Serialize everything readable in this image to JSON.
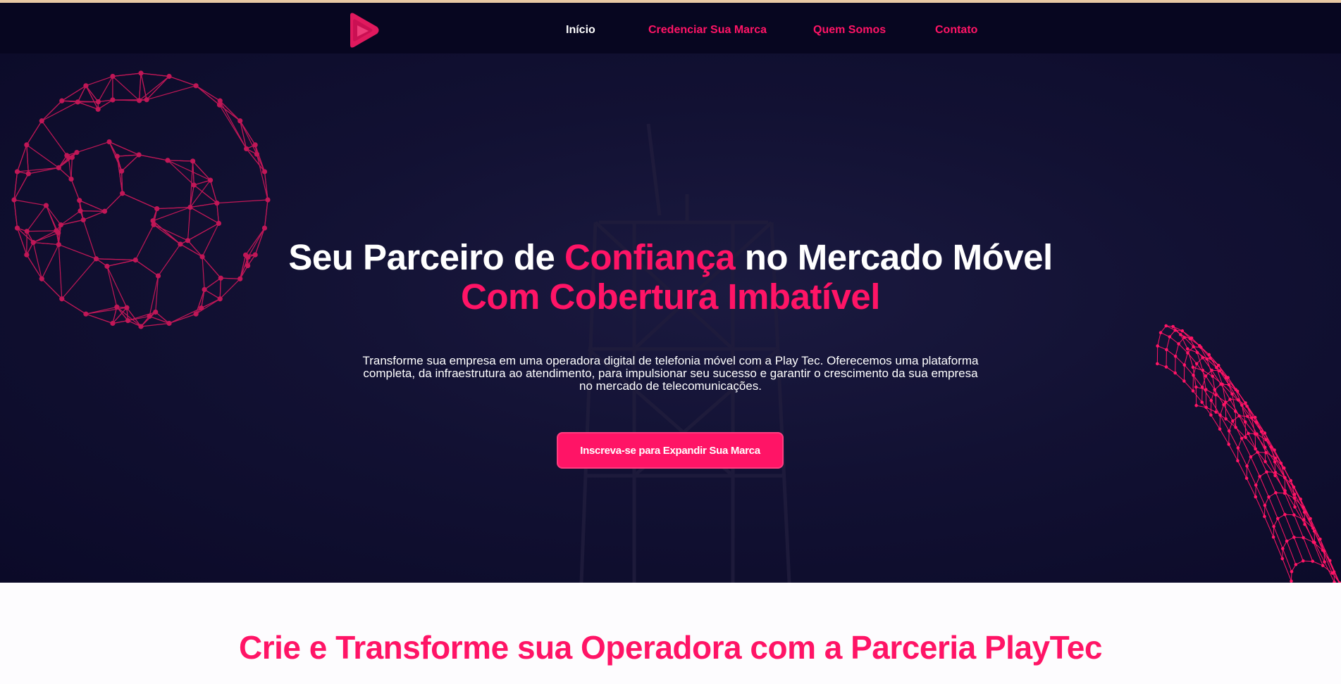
{
  "nav": {
    "logo": "playtec-logo",
    "items": [
      {
        "label": "Início",
        "active": true
      },
      {
        "label": "Credenciar Sua Marca",
        "active": false
      },
      {
        "label": "Quem Somos",
        "active": false
      },
      {
        "label": "Contato",
        "active": false
      }
    ]
  },
  "hero": {
    "title_part1": "Seu Parceiro de ",
    "title_highlight1": "Confiança",
    "title_part2": " no Mercado Móvel ",
    "title_highlight2": "Com Cobertura Imbatível",
    "description": "Transforme sua empresa em uma operadora digital de telefonia móvel com a Play Tec. Oferecemos uma plataforma completa, da infraestrutura ao atendimento, para impulsionar seu sucesso e garantir o crescimento da sua empresa no mercado de telecomunicações.",
    "cta_label": "Inscreva-se para Expandir Sua Marca"
  },
  "section": {
    "title": "Crie e Transforme sua Operadora com a Parceria PlayTec"
  },
  "colors": {
    "accent": "#ff1466",
    "nav_bg": "#070620",
    "hero_bg": "#121133",
    "text_light": "#ffffff"
  },
  "icons": [
    "play-logo-icon",
    "wireframe-sphere-graphic",
    "wireframe-tube-graphic"
  ]
}
